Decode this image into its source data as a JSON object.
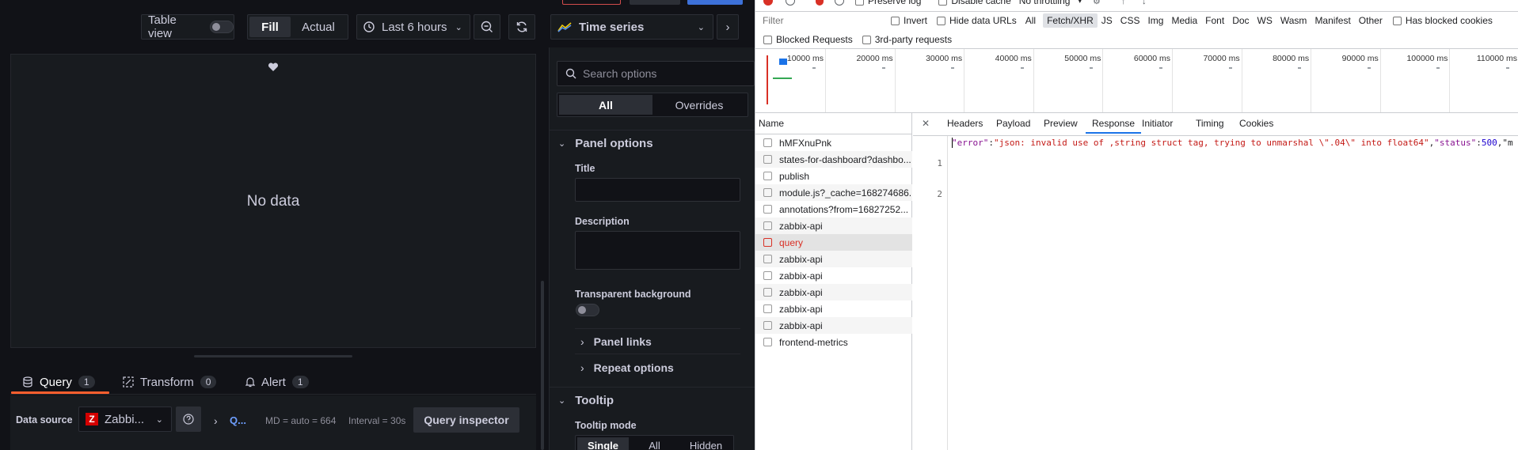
{
  "grafana": {
    "toolbar": {
      "table_view_label": "Table view",
      "fill_label": "Fill",
      "actual_label": "Actual",
      "time_range_label": "Last 6 hours",
      "visualization_label": "Time series"
    },
    "panel": {
      "no_data_text": "No data"
    },
    "query_tabs": [
      {
        "label": "Query",
        "count": "1"
      },
      {
        "label": "Transform",
        "count": "0"
      },
      {
        "label": "Alert",
        "count": "1"
      }
    ],
    "query_row": {
      "data_source_label": "Data source",
      "data_source_value": "Zabbi...",
      "query_name": "Q...",
      "md_text": "MD = auto = 664",
      "interval_text": "Interval = 30s",
      "query_inspector_label": "Query inspector"
    },
    "options": {
      "search_placeholder": "Search options",
      "tab_all": "All",
      "tab_overrides": "Overrides",
      "panel_options_header": "Panel options",
      "title_label": "Title",
      "description_label": "Description",
      "transparent_label": "Transparent background",
      "panel_links_label": "Panel links",
      "repeat_options_label": "Repeat options",
      "tooltip_header": "Tooltip",
      "tooltip_mode_label": "Tooltip mode",
      "tooltip_modes": [
        "Single",
        "All",
        "Hidden"
      ]
    }
  },
  "devtools": {
    "top": {
      "preserve_log": "Preserve log",
      "disable_cache": "Disable cache",
      "throttling": "No throttling"
    },
    "filter": {
      "placeholder": "Filter",
      "invert": "Invert",
      "hide_data_urls": "Hide data URLs",
      "types": [
        "All",
        "Fetch/XHR",
        "JS",
        "CSS",
        "Img",
        "Media",
        "Font",
        "Doc",
        "WS",
        "Wasm",
        "Manifest",
        "Other"
      ],
      "active_type": "Fetch/XHR",
      "has_blocked_cookies": "Has blocked cookies",
      "blocked_requests": "Blocked Requests",
      "third_party": "3rd-party requests"
    },
    "timeline_ticks": [
      "10000 ms",
      "20000 ms",
      "30000 ms",
      "40000 ms",
      "50000 ms",
      "60000 ms",
      "70000 ms",
      "80000 ms",
      "90000 ms",
      "100000 ms",
      "110000 ms"
    ],
    "name_header": "Name",
    "requests": [
      "hMFXnuPnk",
      "states-for-dashboard?dashbo...",
      "publish",
      "module.js?_cache=168274686...",
      "annotations?from=16827252...",
      "zabbix-api",
      "query",
      "zabbix-api",
      "zabbix-api",
      "zabbix-api",
      "zabbix-api",
      "zabbix-api",
      "frontend-metrics"
    ],
    "selected_request": "query",
    "detail_tabs": [
      "Headers",
      "Payload",
      "Preview",
      "Response",
      "Initiator",
      "Timing",
      "Cookies"
    ],
    "active_detail_tab": "Response",
    "response": {
      "line_numbers": [
        "1",
        "2"
      ],
      "key_error": "\"error\"",
      "value_error": "\"json: invalid use of ,string struct tag, trying to unmarshal \\\".04\\\" into float64\"",
      "key_status": "\"status\"",
      "value_status": "500",
      "tail": ",\"m"
    },
    "colors": {
      "accent": "#1a73e8",
      "error": "#d93025",
      "string": "#c41a16",
      "number": "#1c00cf",
      "key": "#881391"
    }
  }
}
